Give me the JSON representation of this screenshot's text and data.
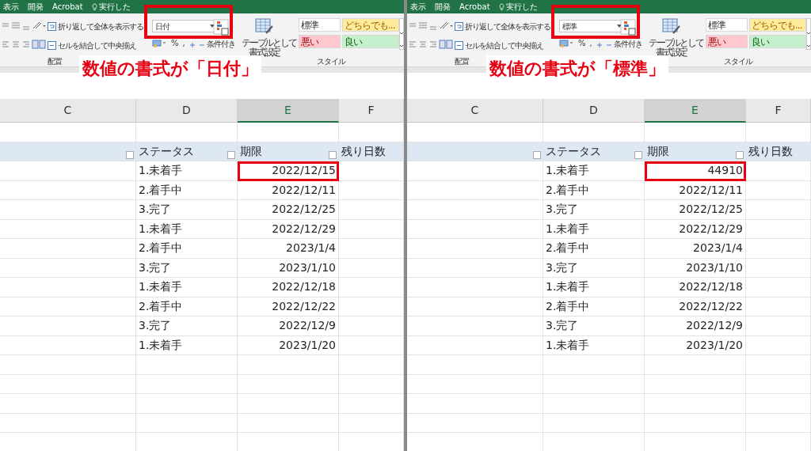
{
  "panels": [
    {
      "menu": [
        "表示",
        "開発",
        "Acrobat"
      ],
      "tell_me": "実行した",
      "ribbon": {
        "wrap_text": "折り返して全体を表示する",
        "merge": "セルを結合して中央揃え",
        "number_format": "日付",
        "percent": "%",
        "comma": ",",
        "conditional": "条件付き",
        "format_table": [
          "テーブルとして",
          "書式設定"
        ],
        "styles": [
          {
            "label": "標準",
            "color": "#ffffff"
          },
          {
            "label": "どちらでも...",
            "color": "#ffeb9c"
          },
          {
            "label": "悪い",
            "color": "#ffc7ce"
          },
          {
            "label": "良い",
            "color": "#c6efce"
          }
        ],
        "groups": [
          "配置",
          "スタイル"
        ]
      },
      "annotation": "数値の書式が「日付」",
      "columns": [
        {
          "label": "C",
          "selected": false
        },
        {
          "label": "D",
          "selected": false
        },
        {
          "label": "E",
          "selected": true
        },
        {
          "label": "F",
          "selected": false
        }
      ],
      "table": {
        "headers": [
          "ステータス",
          "期限",
          "残り日数"
        ],
        "rows": [
          {
            "status": "1.未着手",
            "due": "2022/12/15",
            "highlighted": true
          },
          {
            "status": "2.着手中",
            "due": "2022/12/11",
            "highlighted": false
          },
          {
            "status": "3.完了",
            "due": "2022/12/25",
            "highlighted": false
          },
          {
            "status": "1.未着手",
            "due": "2022/12/29",
            "highlighted": false
          },
          {
            "status": "2.着手中",
            "due": "2023/1/4",
            "highlighted": false
          },
          {
            "status": "3.完了",
            "due": "2023/1/10",
            "highlighted": false
          },
          {
            "status": "1.未着手",
            "due": "2022/12/18",
            "highlighted": false
          },
          {
            "status": "2.着手中",
            "due": "2022/12/22",
            "highlighted": false
          },
          {
            "status": "3.完了",
            "due": "2022/12/9",
            "highlighted": false
          },
          {
            "status": "1.未着手",
            "due": "2023/1/20",
            "highlighted": false
          }
        ]
      }
    },
    {
      "menu": [
        "表示",
        "開発",
        "Acrobat"
      ],
      "tell_me": "実行した",
      "ribbon": {
        "wrap_text": "折り返して全体を表示する",
        "merge": "セルを結合して中央揃え",
        "number_format": "標準",
        "percent": "%",
        "comma": ",",
        "conditional": "条件付き",
        "format_table": [
          "テーブルとして",
          "書式設定"
        ],
        "styles": [
          {
            "label": "標準",
            "color": "#ffffff"
          },
          {
            "label": "どちらでも...",
            "color": "#ffeb9c"
          },
          {
            "label": "悪い",
            "color": "#ffc7ce"
          },
          {
            "label": "良い",
            "color": "#c6efce"
          }
        ],
        "groups": [
          "配置",
          "スタイル"
        ]
      },
      "annotation": "数値の書式が「標準」",
      "columns": [
        {
          "label": "C",
          "selected": false
        },
        {
          "label": "D",
          "selected": false
        },
        {
          "label": "E",
          "selected": true
        },
        {
          "label": "F",
          "selected": false
        }
      ],
      "table": {
        "headers": [
          "ステータス",
          "期限",
          "残り日数"
        ],
        "rows": [
          {
            "status": "1.未着手",
            "due": "44910",
            "highlighted": true
          },
          {
            "status": "2.着手中",
            "due": "2022/12/11",
            "highlighted": false
          },
          {
            "status": "3.完了",
            "due": "2022/12/25",
            "highlighted": false
          },
          {
            "status": "1.未着手",
            "due": "2022/12/29",
            "highlighted": false
          },
          {
            "status": "2.着手中",
            "due": "2023/1/4",
            "highlighted": false
          },
          {
            "status": "3.完了",
            "due": "2023/1/10",
            "highlighted": false
          },
          {
            "status": "1.未着手",
            "due": "2022/12/18",
            "highlighted": false
          },
          {
            "status": "2.着手中",
            "due": "2022/12/22",
            "highlighted": false
          },
          {
            "status": "3.完了",
            "due": "2022/12/9",
            "highlighted": false
          },
          {
            "status": "1.未着手",
            "due": "2023/1/20",
            "highlighted": false
          }
        ]
      }
    }
  ]
}
